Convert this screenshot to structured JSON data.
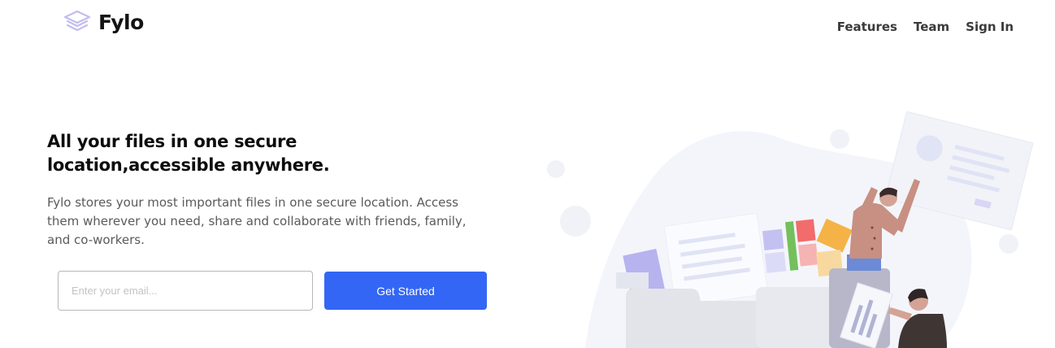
{
  "header": {
    "logo_text": "Fylo",
    "logo_icon": "stacked-layers-icon",
    "nav": [
      {
        "label": "Features"
      },
      {
        "label": "Team"
      },
      {
        "label": "Sign In"
      }
    ]
  },
  "hero": {
    "title": "All your files in one secure location,accessible anywhere.",
    "description": "Fylo stores your most important files in one secure location. Access them wherever you need, share and collaborate with friends, family, and co-workers.",
    "email_placeholder": "Enter your email...",
    "cta_label": "Get Started"
  },
  "colors": {
    "accent": "#3366f5",
    "logo_icon": "#c7c2f2"
  }
}
